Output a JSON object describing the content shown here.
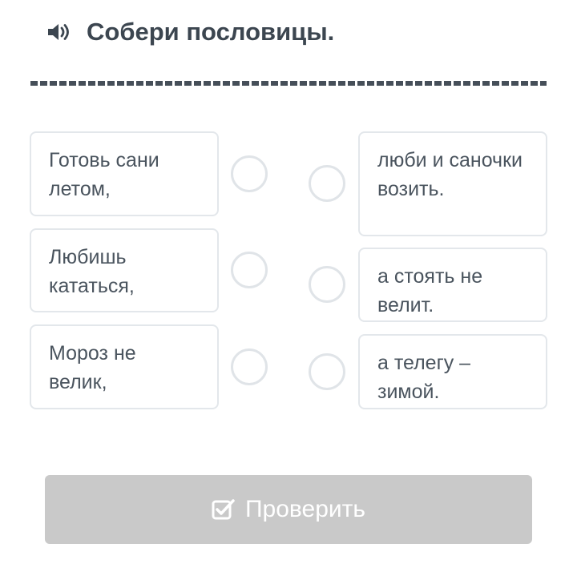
{
  "header": {
    "speaker_icon": "speaker-volume-icon",
    "title": "Собери пословицы."
  },
  "left_items": [
    {
      "text": "Готовь сани летом,"
    },
    {
      "text": "Любишь кататься,"
    },
    {
      "text": "Мороз не велик,"
    }
  ],
  "right_items": [
    {
      "text": "люби и саночки возить."
    },
    {
      "text": "а стоять не велит."
    },
    {
      "text": "а телегу – зимой."
    }
  ],
  "check_button": {
    "label": "Проверить",
    "icon": "checkbox-check-icon"
  },
  "colors": {
    "text": "#3c4650",
    "card_border": "#e3e7eb",
    "button_disabled": "#c9c9c9"
  }
}
